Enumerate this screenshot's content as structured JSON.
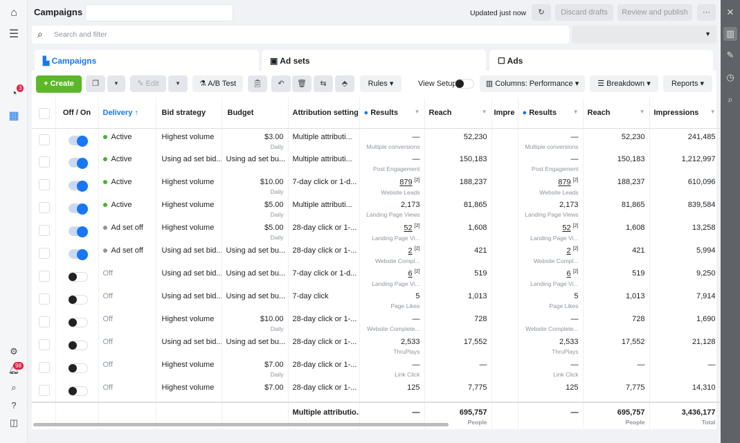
{
  "header": {
    "title": "Campaigns",
    "updated": "Updated just now",
    "discard": "Discard drafts",
    "review": "Review and publish",
    "more": "···"
  },
  "search": {
    "placeholder": "Search and filter"
  },
  "tabs": [
    {
      "label": "Campaigns",
      "active": true
    },
    {
      "label": "Ad sets"
    },
    {
      "label": "Ads"
    }
  ],
  "toolbar": {
    "create": "+  Create",
    "edit": "Edit",
    "ab_test": "A/B Test",
    "rules": "Rules",
    "view_setup": "View Setup",
    "columns": "Columns: Performance",
    "breakdown": "Breakdown",
    "reports": "Reports"
  },
  "left_sidebar": {
    "notif_badge": "3",
    "alerts_badge": "98"
  },
  "columns": [
    "Off / On",
    "Delivery ↑",
    "Bid strategy",
    "Budget",
    "Attribution setting",
    "Results",
    "Reach",
    "Impre",
    "Results",
    "Reach",
    "Impressions"
  ],
  "rows": [
    {
      "on": true,
      "delivery": "Active",
      "status": "active",
      "bid": "Highest volume",
      "budget": "$3.00",
      "budget_sub": "Daily",
      "attr": "Multiple attributi...",
      "results": "—",
      "results_sub": "Multiple conversions",
      "reach": "52,230",
      "impressions": "241,485"
    },
    {
      "on": true,
      "delivery": "Active",
      "status": "active",
      "bid": "Using ad set bid...",
      "budget": "Using ad set bu...",
      "budget_sub": "",
      "attr": "Multiple attributi...",
      "results": "—",
      "results_sub": "Post Engagement",
      "reach": "150,183",
      "impressions": "1,212,997"
    },
    {
      "on": true,
      "delivery": "Active",
      "status": "active",
      "bid": "Highest volume",
      "budget": "$10.00",
      "budget_sub": "Daily",
      "attr": "7-day click or 1-d...",
      "results": "879",
      "results_note": "[2]",
      "results_sub": "Website Leads",
      "reach": "188,237",
      "impressions": "610,096"
    },
    {
      "on": true,
      "delivery": "Active",
      "status": "active",
      "bid": "Highest volume",
      "budget": "$5.00",
      "budget_sub": "Daily",
      "attr": "Multiple attributi...",
      "results": "2,173",
      "results_sub": "Landing Page Views",
      "reach": "81,865",
      "impressions": "839,584"
    },
    {
      "on": true,
      "delivery": "Ad set off",
      "status": "off",
      "bid": "Highest volume",
      "budget": "$5.00",
      "budget_sub": "Daily",
      "attr": "28-day click or 1-...",
      "results": "52",
      "results_note": "[2]",
      "results_sub": "Landing Page Vi...",
      "reach": "1,608",
      "impressions": "13,258"
    },
    {
      "on": true,
      "delivery": "Ad set off",
      "status": "off",
      "bid": "Using ad set bid...",
      "budget": "Using ad set bu...",
      "budget_sub": "",
      "attr": "28-day click or 1-...",
      "results": "2",
      "results_note": "[2]",
      "results_sub": "Website Compl...",
      "reach": "421",
      "impressions": "5,994"
    },
    {
      "on": false,
      "delivery": "Off",
      "status": "",
      "bid": "Using ad set bid...",
      "budget": "Using ad set bu...",
      "budget_sub": "",
      "attr": "7-day click or 1-d...",
      "results": "6",
      "results_note": "[2]",
      "results_sub": "Landing Page Vi...",
      "reach": "519",
      "impressions": "9,250"
    },
    {
      "on": false,
      "delivery": "Off",
      "status": "",
      "bid": "Using ad set bid...",
      "budget": "Using ad set bu...",
      "budget_sub": "",
      "attr": "7-day click",
      "results": "5",
      "results_sub": "Page Likes",
      "reach": "1,013",
      "impressions": "7,914"
    },
    {
      "on": false,
      "delivery": "Off",
      "status": "",
      "bid": "Highest volume",
      "budget": "$10.00",
      "budget_sub": "Daily",
      "attr": "28-day click or 1-...",
      "results": "—",
      "results_sub": "Website Complete...",
      "reach": "728",
      "impressions": "1,690"
    },
    {
      "on": false,
      "delivery": "Off",
      "status": "",
      "bid": "Using ad set bid...",
      "budget": "Using ad set bu...",
      "budget_sub": "",
      "attr": "28-day click or 1-...",
      "results": "2,533",
      "results_sub": "ThruPlays",
      "reach": "17,552",
      "impressions": "21,128"
    },
    {
      "on": false,
      "delivery": "Off",
      "status": "",
      "bid": "Highest volume",
      "budget": "$7.00",
      "budget_sub": "Daily",
      "attr": "28-day click or 1-...",
      "results": "—",
      "results_sub": "Link Click",
      "reach": "—",
      "impressions": "—"
    },
    {
      "on": false,
      "delivery": "Off",
      "status": "",
      "bid": "Highest volume",
      "budget": "$7.00",
      "budget_sub": "",
      "attr": "28-day click or 1-...",
      "results": "125",
      "results_sub": "",
      "reach": "7,775",
      "impressions": "14,310"
    }
  ],
  "totals": {
    "attr": "Multiple attributio...",
    "results": "—",
    "reach": "695,757",
    "reach_sub": "People",
    "impressions": "3,436,177",
    "impressions_sub": "Total"
  },
  "colors": {
    "active": "#42b72a",
    "off": "#8d949e",
    "accent": "#1877f2",
    "create": "#5cb82a"
  }
}
